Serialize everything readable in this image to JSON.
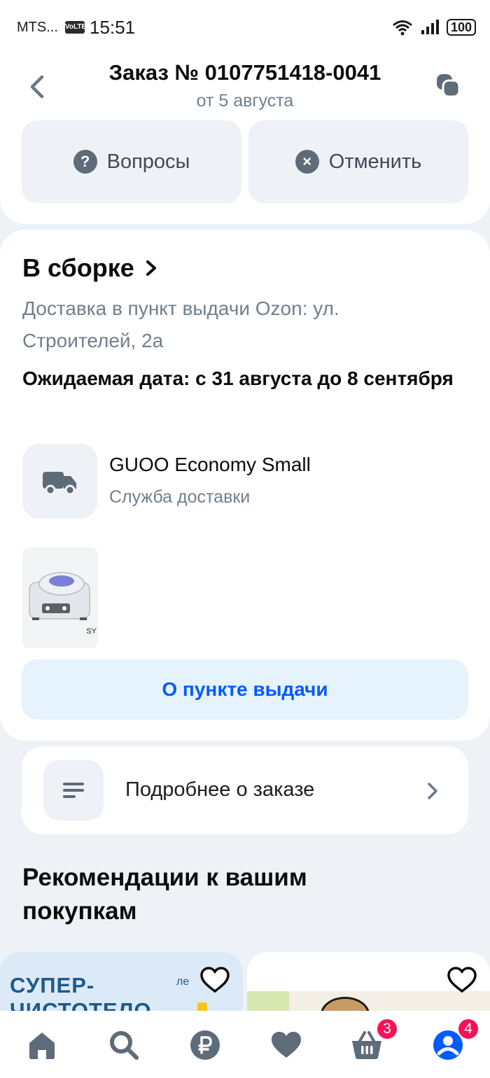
{
  "status_bar": {
    "carrier": "MTS...",
    "volte": "VoLTE",
    "time": "15:51",
    "battery": "100"
  },
  "header": {
    "title": "Заказ № 0107751418-0041",
    "date": "от 5 августа"
  },
  "actions": {
    "questions": "Вопросы",
    "cancel": "Отменить"
  },
  "order": {
    "status": "В сборке",
    "delivery_address": "Доставка в пункт выдачи Ozon: ул. Строителей, 2а",
    "expected_date": "Ожидаемая дата: с 31 августа до 8 сентября",
    "service_name": "GUOO Economy Small",
    "service_label": "Служба доставки",
    "product_caption": "SY",
    "pickup_button": "О пункте выдачи"
  },
  "details": {
    "label": "Подробнее о заказе"
  },
  "recommendations": {
    "title": "Рекомендации к вашим покупкам",
    "promo_text": "СУПЕР-\nЧИСТОТЕЛО",
    "promo_logo": "ле"
  },
  "nav": {
    "items": [
      "home",
      "search",
      "payments",
      "favorites",
      "cart",
      "profile"
    ],
    "cart_badge": "3",
    "profile_badge": "4"
  },
  "colors": {
    "accent": "#005bff",
    "badge": "#f91155",
    "muted": "#707f8d",
    "icon": "#5e6b78"
  }
}
